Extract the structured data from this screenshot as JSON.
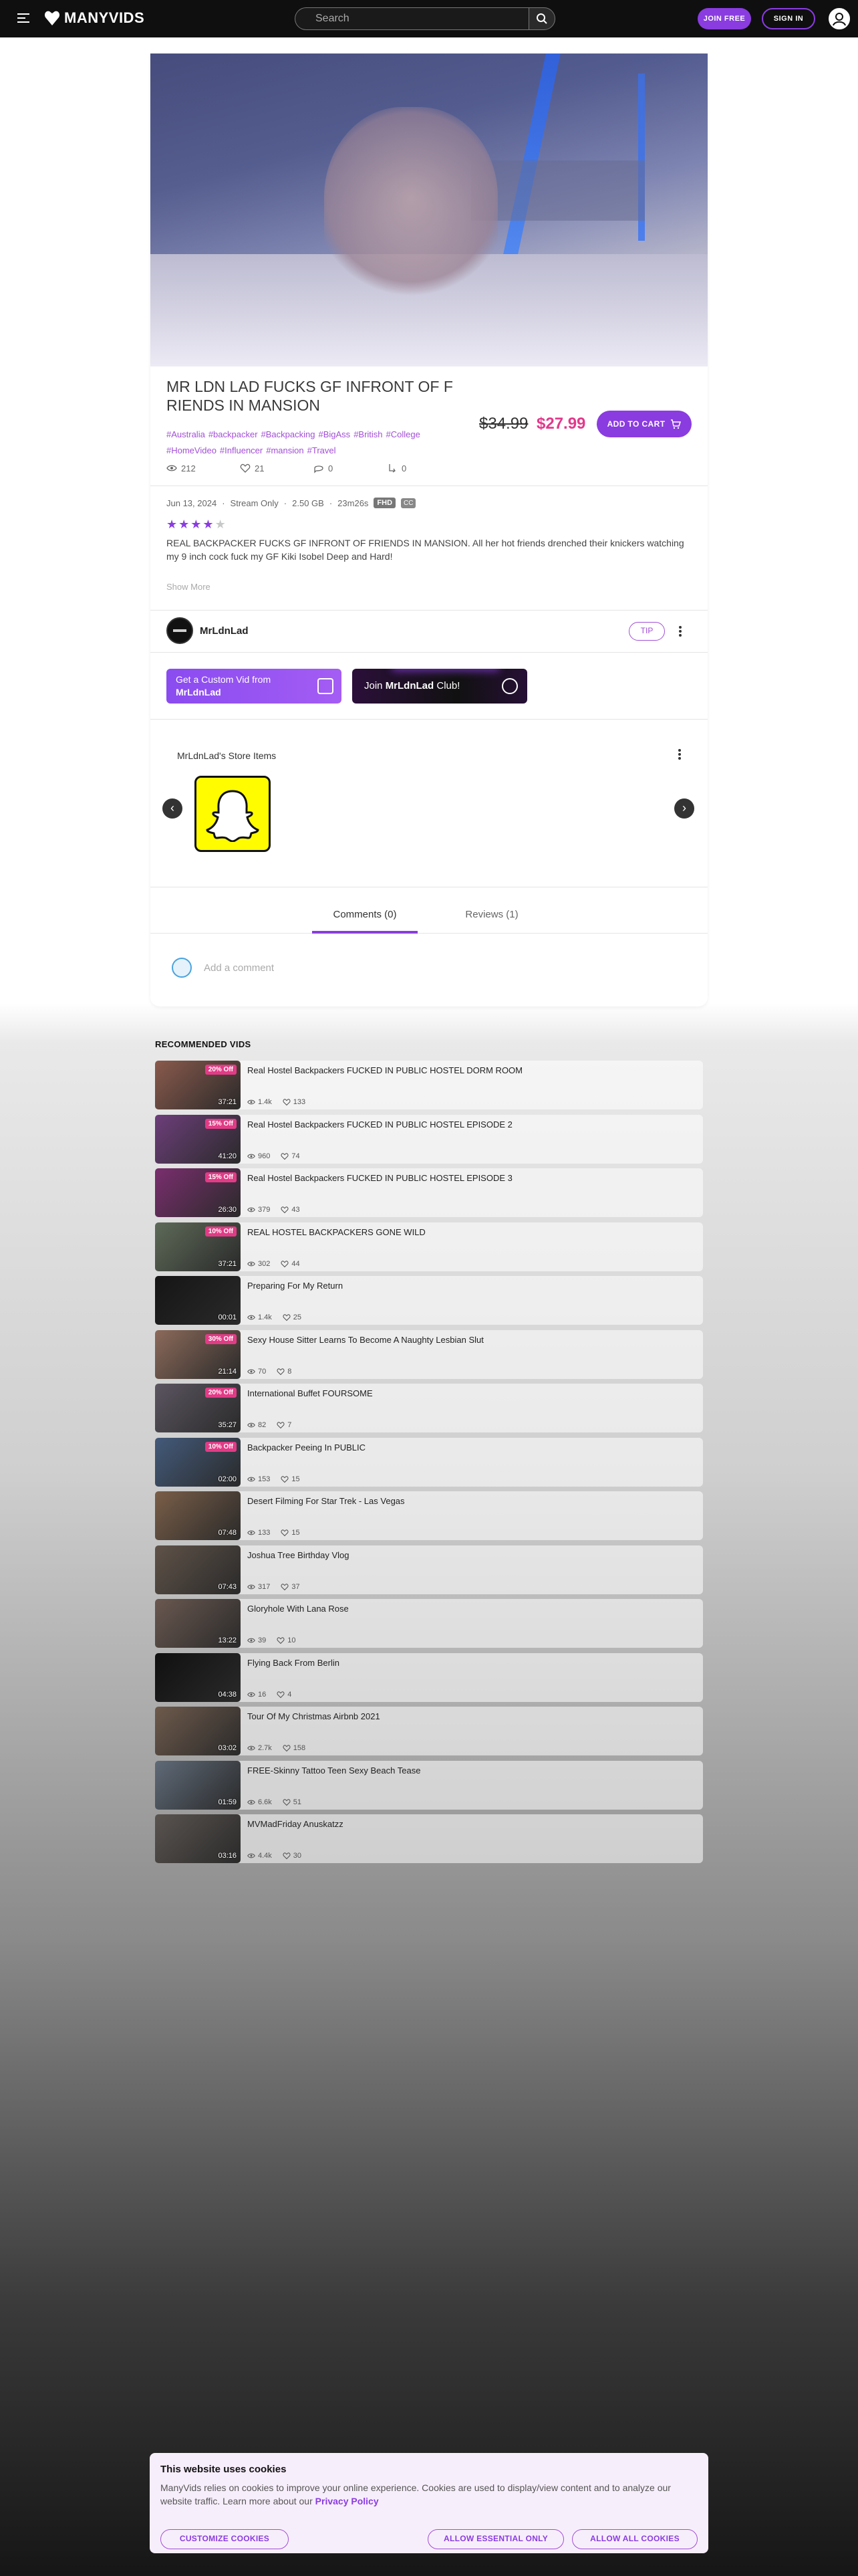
{
  "header": {
    "logo_text": "MANYVIDS",
    "search_placeholder": "Search",
    "join_label": "JOIN FREE",
    "signin_label": "SIGN IN"
  },
  "video": {
    "title": "MR LDN LAD FUCKS GF INFRONT OF F RIENDS IN MANSION",
    "tags": [
      "#Australia",
      "#backpacker",
      "#Backpacking",
      "#BigAss",
      "#British",
      "#College",
      "#HomeVideo",
      "#Influencer",
      "#mansion",
      "#Travel"
    ],
    "stats": {
      "views": "212",
      "likes": "21",
      "comments": "0",
      "shares": "0"
    },
    "price_old": "$34.99",
    "price_new": "$27.99",
    "add_to_cart": "ADD TO CART",
    "date": "Jun 13, 2024",
    "stream": "Stream Only",
    "size": "2.50 GB",
    "duration": "23m26s",
    "quality": "FHD",
    "cc": "CC",
    "rating_stars": 4,
    "rating_max": 5,
    "description": "REAL BACKPACKER FUCKS GF INFRONT OF FRIENDS IN MANSION. All her hot friends drenched their knickers watching my 9 inch cock fuck my GF Kiki Isobel Deep and Hard!",
    "show_more": "Show More"
  },
  "creator": {
    "name": "MrLdnLad",
    "tip_label": "TIP",
    "custom_vid_line1": "Get a Custom Vid from",
    "custom_vid_line2": "MrLdnLad",
    "join_prefix": "Join ",
    "join_name": "MrLdnLad",
    "join_suffix": " Club!",
    "store_title": "MrLdnLad's Store Items"
  },
  "tabs": {
    "comments": "Comments (0)",
    "reviews": "Reviews (1)"
  },
  "comment_placeholder": "Add a comment",
  "recommended": {
    "title": "RECOMMENDED VIDS",
    "items": [
      {
        "title": "Real Hostel Backpackers FUCKED IN PUBLIC HOSTEL DORM ROOM",
        "discount": "20% Off",
        "duration": "37:21",
        "views": "1.4k",
        "likes": "133",
        "thumb": "#8a5a4c"
      },
      {
        "title": "Real Hostel Backpackers FUCKED IN PUBLIC HOSTEL EPISODE 2",
        "discount": "15% Off",
        "duration": "41:20",
        "views": "960",
        "likes": "74",
        "thumb": "#6d3e7a"
      },
      {
        "title": "Real Hostel Backpackers FUCKED IN PUBLIC HOSTEL EPISODE 3",
        "discount": "15% Off",
        "duration": "26:30",
        "views": "379",
        "likes": "43",
        "thumb": "#7a2e6e"
      },
      {
        "title": "REAL HOSTEL BACKPACKERS GONE WILD",
        "discount": "10% Off",
        "duration": "37:21",
        "views": "302",
        "likes": "44",
        "thumb": "#5e6a58"
      },
      {
        "title": "Preparing For My Return",
        "discount": "",
        "duration": "00:01",
        "views": "1.4k",
        "likes": "25",
        "thumb": "#151515"
      },
      {
        "title": "Sexy House Sitter Learns To Become A Naughty Lesbian Slut",
        "discount": "30% Off",
        "duration": "21:14",
        "views": "70",
        "likes": "8",
        "thumb": "#8c6a5a"
      },
      {
        "title": "International Buffet FOURSOME",
        "discount": "20% Off",
        "duration": "35:27",
        "views": "82",
        "likes": "7",
        "thumb": "#5b5560"
      },
      {
        "title": "Backpacker Peeing In PUBLIC",
        "discount": "10% Off",
        "duration": "02:00",
        "views": "153",
        "likes": "15",
        "thumb": "#435a7a"
      },
      {
        "title": "Desert Filming For Star Trek - Las Vegas",
        "discount": "",
        "duration": "07:48",
        "views": "133",
        "likes": "15",
        "thumb": "#7a5e48"
      },
      {
        "title": "Joshua Tree Birthday Vlog",
        "discount": "",
        "duration": "07:43",
        "views": "317",
        "likes": "37",
        "thumb": "#5f5248"
      },
      {
        "title": "Gloryhole With Lana Rose",
        "discount": "",
        "duration": "13:22",
        "views": "39",
        "likes": "10",
        "thumb": "#6a5850"
      },
      {
        "title": "Flying Back From Berlin",
        "discount": "",
        "duration": "04:38",
        "views": "16",
        "likes": "4",
        "thumb": "#101010"
      },
      {
        "title": "Tour Of My Christmas Airbnb 2021",
        "discount": "",
        "duration": "03:02",
        "views": "2.7k",
        "likes": "158",
        "thumb": "#6e5a4c"
      },
      {
        "title": "FREE-Skinny Tattoo Teen Sexy Beach Tease",
        "discount": "",
        "duration": "01:59",
        "views": "6.6k",
        "likes": "51",
        "thumb": "#5f6a78"
      },
      {
        "title": "MVMadFriday Anuskatzz",
        "discount": "",
        "duration": "03:16",
        "views": "4.4k",
        "likes": "30",
        "thumb": "#5a5450"
      }
    ]
  },
  "cookie": {
    "title": "This website uses cookies",
    "text": "ManyVids relies on cookies to improve your online experience. Cookies are used to display/view content and to analyze our website traffic. Learn more about our ",
    "link": "Privacy Policy",
    "customize": "CUSTOMIZE COOKIES",
    "essential": "ALLOW ESSENTIAL ONLY",
    "all": "ALLOW ALL COOKIES"
  }
}
